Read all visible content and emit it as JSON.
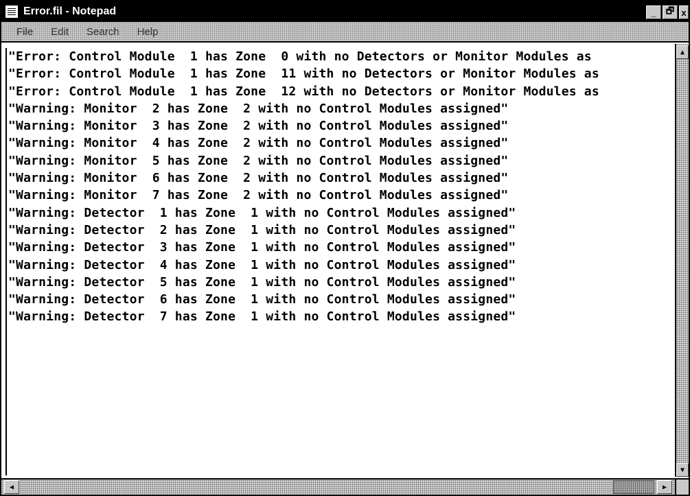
{
  "window": {
    "title": "Error.fil - Notepad",
    "buttons": {
      "minimize": "_",
      "maximize": "🗗",
      "close": "x"
    }
  },
  "menu": [
    "File",
    "Edit",
    "Search",
    "Help"
  ],
  "lines": [
    "\"Error: Control Module  1 has Zone  0 with no Detectors or Monitor Modules as",
    "\"Error: Control Module  1 has Zone  11 with no Detectors or Monitor Modules as",
    "\"Error: Control Module  1 has Zone  12 with no Detectors or Monitor Modules as",
    "\"Warning: Monitor  2 has Zone  2 with no Control Modules assigned\"",
    "\"Warning: Monitor  3 has Zone  2 with no Control Modules assigned\"",
    "\"Warning: Monitor  4 has Zone  2 with no Control Modules assigned\"",
    "\"Warning: Monitor  5 has Zone  2 with no Control Modules assigned\"",
    "\"Warning: Monitor  6 has Zone  2 with no Control Modules assigned\"",
    "\"Warning: Monitor  7 has Zone  2 with no Control Modules assigned\"",
    "\"Warning: Detector  1 has Zone  1 with no Control Modules assigned\"",
    "\"Warning: Detector  2 has Zone  1 with no Control Modules assigned\"",
    "\"Warning: Detector  3 has Zone  1 with no Control Modules assigned\"",
    "\"Warning: Detector  4 has Zone  1 with no Control Modules assigned\"",
    "\"Warning: Detector  5 has Zone  1 with no Control Modules assigned\"",
    "\"Warning: Detector  6 has Zone  1 with no Control Modules assigned\"",
    "\"Warning: Detector  7 has Zone  1 with no Control Modules assigned\""
  ],
  "scrollbars": {
    "up_arrow": "▲",
    "down_arrow": "▼",
    "left_arrow": "◀",
    "right_arrow": "▶"
  }
}
